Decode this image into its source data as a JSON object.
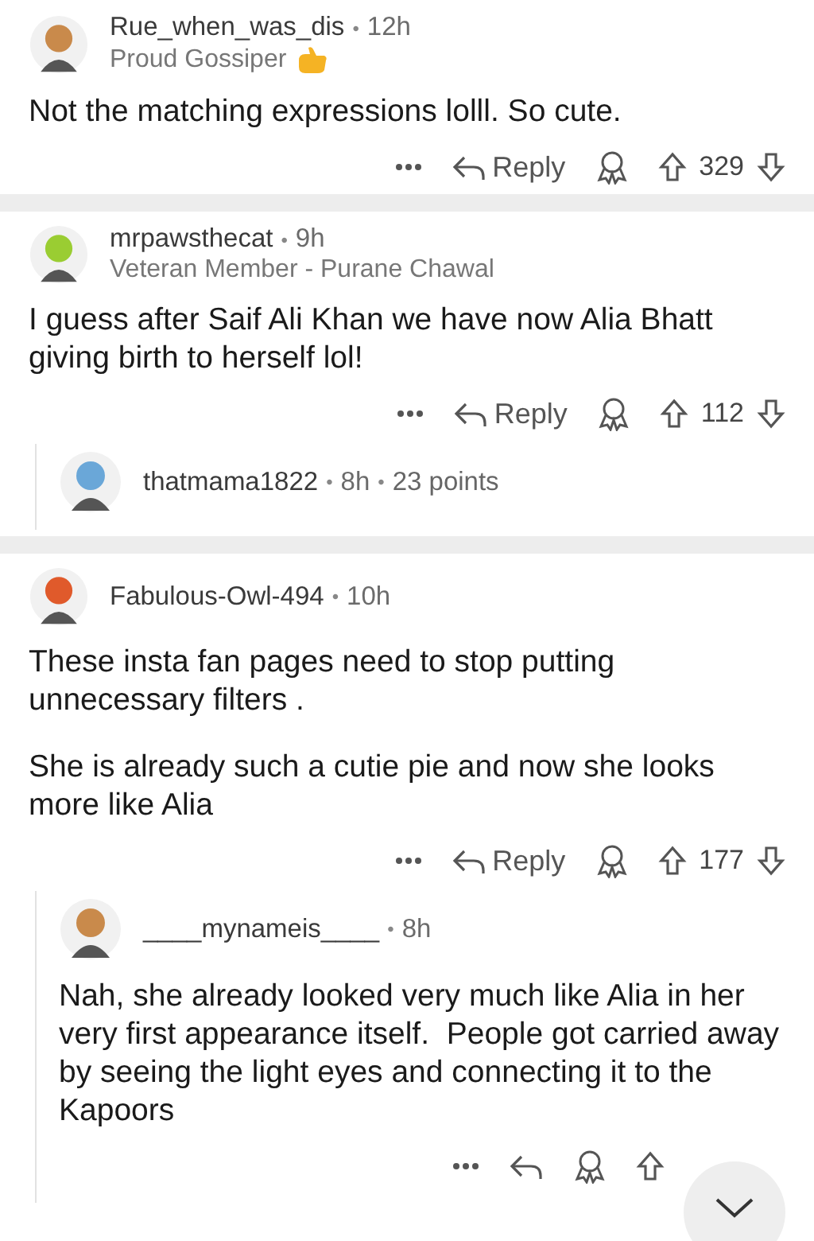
{
  "threads": [
    {
      "author": "Rue_when_was_dis",
      "dot": "•",
      "time": "12h",
      "flair": "Proud Gossiper",
      "flair_icon": true,
      "paragraphs": [
        "Not the matching expressions lolll. So cute."
      ],
      "reply_label": "Reply",
      "score": "329"
    },
    {
      "author": "mrpawsthecat",
      "dot": "•",
      "time": "9h",
      "flair": "Veteran Member - Purane Chawal",
      "flair_icon": false,
      "paragraphs": [
        "I guess after Saif Ali Khan we have now Alia Bhatt giving birth to herself lol!"
      ],
      "reply_label": "Reply",
      "score": "112",
      "replies": [
        {
          "author": "thatmama1822",
          "dot": "•",
          "time": "8h",
          "points_dot": "•",
          "points": "23 points",
          "collapsed": true
        }
      ]
    },
    {
      "author": "Fabulous-Owl-494",
      "dot": "•",
      "time": "10h",
      "flair_icon": false,
      "paragraphs": [
        "These insta fan pages need to stop putting unnecessary filters .",
        "She is already such a cutie pie and now she looks more like Alia"
      ],
      "reply_label": "Reply",
      "score": "177",
      "replies": [
        {
          "author": "____mynameis____",
          "dot": "•",
          "time": "8h",
          "collapsed": false,
          "paragraphs": [
            "Nah, she already looked very much like Alia in her very first appearance itself.  People got carried away by seeing the light eyes and connecting it to the Kapoors"
          ]
        }
      ]
    }
  ]
}
